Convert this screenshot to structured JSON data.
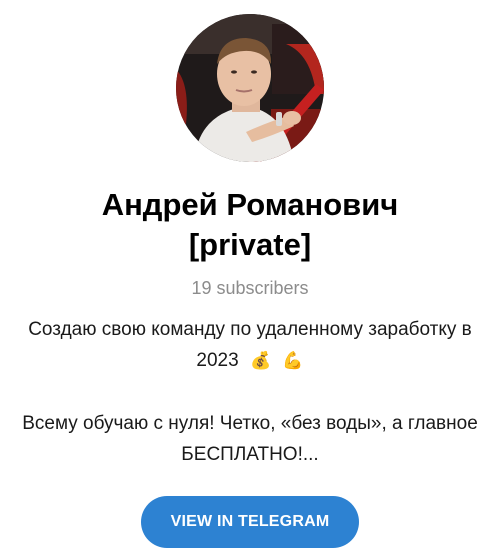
{
  "channel": {
    "title": "Андрей Романович [private]",
    "subscribers": "19 subscribers",
    "description_line1": "Создаю свою команду по удаленному заработку в 2023",
    "emoji1": "💰",
    "emoji2": "💪",
    "description_line2": "Всему обучаю с нуля! Четко, «без воды», а главное БЕСПЛАТНО!..."
  },
  "button": {
    "label": "VIEW IN TELEGRAM"
  },
  "colors": {
    "button_background": "#2d82d2",
    "subscribers_text": "#8c8c8c"
  }
}
